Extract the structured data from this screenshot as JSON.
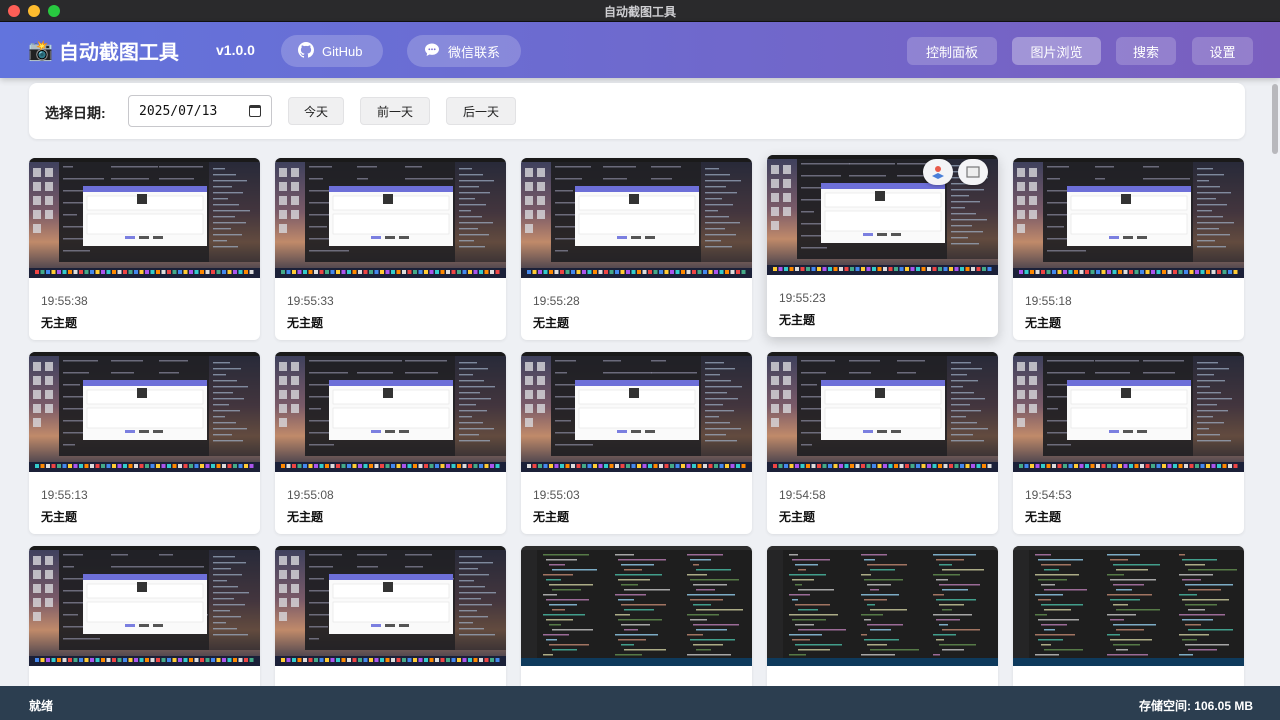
{
  "window": {
    "title": "自动截图工具"
  },
  "header": {
    "app_icon": "camera-emoji",
    "app_name": "自动截图工具",
    "version": "v1.0.0",
    "github_label": "GitHub",
    "wechat_label": "微信联系",
    "nav": {
      "control": "控制面板",
      "browse": "图片浏览",
      "search": "搜索",
      "settings": "设置"
    },
    "active_nav": "browse",
    "gradient_start": "#6274dd",
    "gradient_end": "#7a5fbf"
  },
  "date_panel": {
    "label": "选择日期:",
    "date_value": "2025/07/13",
    "today_label": "今天",
    "prev_label": "前一天",
    "next_label": "后一天"
  },
  "cards": [
    {
      "time": "19:55:38",
      "title": "无主题",
      "thumb": "desktop"
    },
    {
      "time": "19:55:33",
      "title": "无主题",
      "thumb": "desktop"
    },
    {
      "time": "19:55:28",
      "title": "无主题",
      "thumb": "desktop"
    },
    {
      "time": "19:55:23",
      "title": "无主题",
      "thumb": "desktop",
      "hovered": true
    },
    {
      "time": "19:55:18",
      "title": "无主题",
      "thumb": "desktop"
    },
    {
      "time": "19:55:13",
      "title": "无主题",
      "thumb": "desktop"
    },
    {
      "time": "19:55:08",
      "title": "无主题",
      "thumb": "desktop"
    },
    {
      "time": "19:55:03",
      "title": "无主题",
      "thumb": "desktop"
    },
    {
      "time": "19:54:58",
      "title": "无主题",
      "thumb": "desktop"
    },
    {
      "time": "19:54:53",
      "title": "无主题",
      "thumb": "desktop"
    },
    {
      "time": "",
      "title": "",
      "thumb": "desktop"
    },
    {
      "time": "",
      "title": "",
      "thumb": "desktop"
    },
    {
      "time": "",
      "title": "",
      "thumb": "code"
    },
    {
      "time": "",
      "title": "",
      "thumb": "code"
    },
    {
      "time": "",
      "title": "",
      "thumb": "code"
    }
  ],
  "status": {
    "left": "就绪",
    "right": "存储空间: 106.05 MB",
    "bg_color": "#2c3e50"
  }
}
